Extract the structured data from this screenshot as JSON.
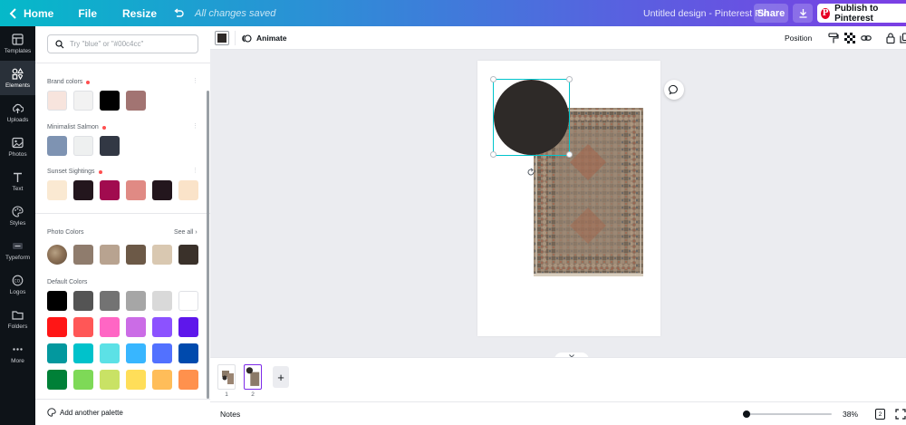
{
  "topbar": {
    "home": "Home",
    "file": "File",
    "resize": "Resize",
    "saved_status": "All changes saved",
    "doc_title": "Untitled design - Pinterest Pin",
    "share": "Share",
    "publish": "Publish to Pinterest"
  },
  "rail": {
    "items": [
      {
        "label": "Templates",
        "icon": "templates-icon"
      },
      {
        "label": "Elements",
        "icon": "elements-icon"
      },
      {
        "label": "Uploads",
        "icon": "uploads-icon"
      },
      {
        "label": "Photos",
        "icon": "photos-icon"
      },
      {
        "label": "Text",
        "icon": "text-icon"
      },
      {
        "label": "Styles",
        "icon": "styles-icon"
      },
      {
        "label": "Typeform",
        "icon": "typeform-icon"
      },
      {
        "label": "Logos",
        "icon": "logos-icon"
      },
      {
        "label": "Folders",
        "icon": "folders-icon"
      },
      {
        "label": "More",
        "icon": "more-icon"
      }
    ],
    "active": "Elements"
  },
  "panel": {
    "search_placeholder": "Try \"blue\" or \"#00c4cc\"",
    "brand_colors": {
      "title": "Brand colors",
      "colors": [
        "#f7e4dd",
        "#f2f2f2",
        "#000000",
        "#a27472"
      ]
    },
    "minimalist_salmon": {
      "title": "Minimalist Salmon",
      "colors": [
        "#7e93b2",
        "#eef0f0",
        "#323844"
      ]
    },
    "sunset_sightings": {
      "title": "Sunset Sightings",
      "colors": [
        "#fae9d2",
        "#23161d",
        "#a10b4f",
        "#e08a84",
        "#23161d",
        "#fae3c9"
      ]
    },
    "photo_colors": {
      "title": "Photo Colors",
      "see_all": "See all",
      "colors": [
        "#8f7c6d",
        "#b8a390",
        "#6c5947",
        "#d9c8b1",
        "#3a312a"
      ]
    },
    "default_colors": {
      "title": "Default Colors",
      "rows": [
        [
          "#000000",
          "#545454",
          "#737373",
          "#a6a6a6",
          "#d9d9d9",
          "#ffffff"
        ],
        [
          "#ff1616",
          "#ff5757",
          "#ff66c4",
          "#cb6ce6",
          "#8c52ff",
          "#5e17eb"
        ],
        [
          "#03989e",
          "#00c2cb",
          "#5ce1e6",
          "#38b6ff",
          "#5271ff",
          "#004aad"
        ],
        [
          "#008037",
          "#7ed957",
          "#c9e265",
          "#ffde59",
          "#ffbd59",
          "#ff914d"
        ]
      ]
    },
    "add_palette": "Add another palette"
  },
  "toolbar": {
    "current_color": "#2e2a28",
    "animate": "Animate",
    "position": "Position"
  },
  "canvas": {
    "circle_color": "#2e2a28"
  },
  "pages": {
    "thumbs": [
      "1",
      "2"
    ],
    "active": "2",
    "add": "+"
  },
  "footer": {
    "notes": "Notes",
    "zoom": "38%",
    "zoom_fraction": 0.04,
    "page_count": "2"
  }
}
